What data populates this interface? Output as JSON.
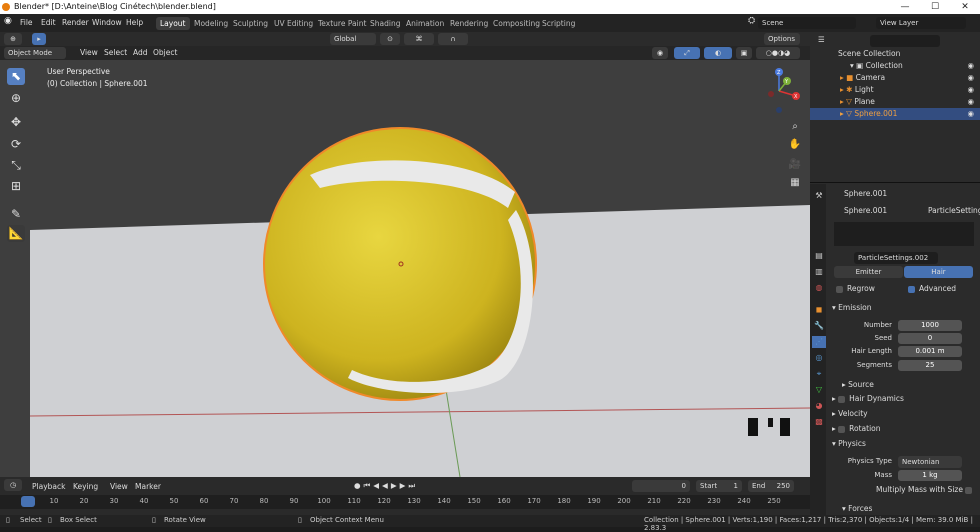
{
  "window": {
    "title": "Blender* [D:\\Anteine\\Blog Cinétech\\blender.blend]",
    "minimize": "—",
    "maximize": "☐",
    "close": "✕"
  },
  "menu": [
    "File",
    "Edit",
    "Render",
    "Window",
    "Help"
  ],
  "workspaces": [
    "Layout",
    "Modeling",
    "Sculpting",
    "UV Editing",
    "Texture Paint",
    "Shading",
    "Animation",
    "Rendering",
    "Compositing",
    "Scripting"
  ],
  "scene": "Scene",
  "view_layer": "View Layer",
  "toolbar": {
    "transform": "Global",
    "options": "Options"
  },
  "header3d": {
    "mode": "Object Mode",
    "view": "View",
    "select": "Select",
    "add": "Add",
    "object": "Object"
  },
  "viewport": {
    "perspective": "User Perspective",
    "context": "(0) Collection | Sphere.001",
    "axis": {
      "x": "X",
      "y": "Y",
      "z": "Z"
    }
  },
  "outliner": {
    "root": "Scene Collection",
    "items": [
      {
        "name": "Collection"
      },
      {
        "name": "Camera"
      },
      {
        "name": "Light"
      },
      {
        "name": "Plane"
      },
      {
        "name": "Sphere.001"
      }
    ]
  },
  "properties": {
    "object_name": "Sphere.001",
    "object_name2": "Sphere.001",
    "particle_settings": "ParticleSettings",
    "particle_data": "ParticleSettings.002",
    "emitter": "Emitter",
    "hair": "Hair",
    "regrow": "Regrow",
    "advanced": "Advanced",
    "emission": "Emission",
    "fields": [
      {
        "label": "Number",
        "value": "1000"
      },
      {
        "label": "Seed",
        "value": "0"
      },
      {
        "label": "Hair Length",
        "value": "0.001 m"
      },
      {
        "label": "Segments",
        "value": "25"
      }
    ],
    "source": "Source",
    "hair_dynamics": "Hair Dynamics",
    "velocity": "Velocity",
    "rotation": "Rotation",
    "physics": "Physics",
    "physics_type_label": "Physics Type",
    "physics_type": "Newtonian",
    "mass_label": "Mass",
    "mass": "1 kg",
    "multiply_mass": "Multiply Mass with Size",
    "forces": "Forces"
  },
  "timeline": {
    "playback": "Playback",
    "keying": "Keying",
    "view": "View",
    "marker": "Marker",
    "current": "0",
    "start_label": "Start",
    "start": "1",
    "end_label": "End",
    "end": "250",
    "ticks": [
      "0",
      "10",
      "20",
      "30",
      "40",
      "50",
      "60",
      "70",
      "80",
      "90",
      "100",
      "110",
      "120",
      "130",
      "140",
      "150",
      "160",
      "170",
      "180",
      "190",
      "200",
      "210",
      "220",
      "230",
      "240",
      "250"
    ]
  },
  "status": {
    "select": "Select",
    "box_select": "Box Select",
    "rotate": "Rotate View",
    "context_menu": "Object Context Menu",
    "stats": "Collection | Sphere.001 | Verts:1,190 | Faces:1,217 | Tris:2,370 | Objects:1/4 | Mem: 39.0 MiB | 2.83.3"
  },
  "colors": {
    "accent": "#4772b3",
    "ball": "#d9c22a",
    "selection": "#f0892a"
  }
}
